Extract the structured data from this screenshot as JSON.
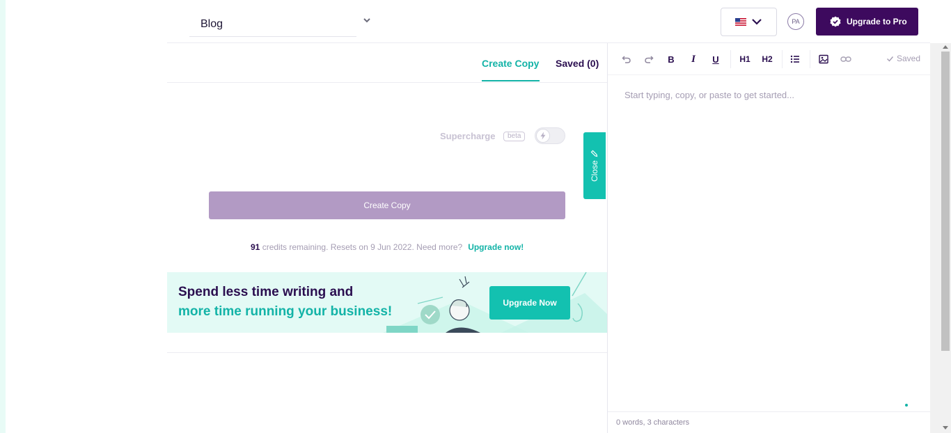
{
  "header": {
    "document_type": "Blog",
    "avatar_initials": "PA",
    "upgrade_pro_label": "Upgrade to Pro"
  },
  "tabs": [
    {
      "label": "Create Copy",
      "active": true
    },
    {
      "label": "Saved (0)",
      "active": false
    }
  ],
  "form": {
    "supercharge_label": "Supercharge",
    "beta_badge": "beta",
    "supercharge_enabled": false,
    "create_button_label": "Create Copy",
    "credits_count": "91",
    "credits_text": " credits remaining. Resets on 9 Jun 2022. Need more?",
    "upgrade_link": "Upgrade now!"
  },
  "close_tab": {
    "label": "Close"
  },
  "banner": {
    "line1": "Spend less time writing and",
    "line2": "more time running your business!",
    "button_label": "Upgrade Now"
  },
  "editor": {
    "toolbar": {
      "h1": "H1",
      "h2": "H2",
      "bold": "B",
      "italic": "I",
      "underline": "U",
      "saved_label": "Saved"
    },
    "placeholder": "Start typing, copy, or paste to get started...",
    "word_count": "0 words, 3 characters"
  },
  "colors": {
    "primary_purple": "#3d0a5e",
    "teal": "#13b3a7",
    "disabled_button": "#b29ac4",
    "banner_bg": "#e3faf5"
  },
  "icons": [
    "chevron-down-icon",
    "us-flag-icon",
    "verified-badge-icon",
    "bolt-icon",
    "pencil-icon",
    "undo-icon",
    "redo-icon",
    "list-icon",
    "image-icon",
    "link-icon",
    "check-icon"
  ]
}
